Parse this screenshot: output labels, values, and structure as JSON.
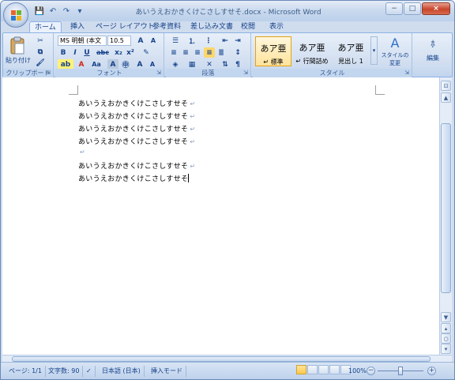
{
  "window": {
    "title": "あいうえおかきくけこさしすせそ.docx - Microsoft Word",
    "minimize": "−",
    "maximize": "□",
    "close": "×"
  },
  "qat": {
    "save": "💾",
    "undo": "↶",
    "redo": "↷",
    "customize": "▾"
  },
  "tabs": [
    "ホーム",
    "挿入",
    "ページ レイアウト",
    "参考資料",
    "差し込み文書",
    "校閲",
    "表示"
  ],
  "ribbon": {
    "clipboard": {
      "label": "クリップボード",
      "paste": "貼り付け"
    },
    "font": {
      "label": "フォント",
      "font_name": "MS 明朝 (本文",
      "font_size": "10.5",
      "bold": "B",
      "italic": "I",
      "underline": "U",
      "strike": "abc",
      "subscript": "x₂",
      "superscript": "x²",
      "grow": "A",
      "shrink": "A",
      "aa": "Aa"
    },
    "paragraph": {
      "label": "段落"
    },
    "styles": {
      "label": "スタイル",
      "items": [
        {
          "preview": "あア亜",
          "name": "↵ 標準"
        },
        {
          "preview": "あア亜",
          "name": "↵ 行間詰め"
        },
        {
          "preview": "あア亜",
          "name": "見出し 1"
        }
      ],
      "change_styles": "スタイルの変更"
    },
    "editing": {
      "label": "編集"
    }
  },
  "document": {
    "lines": [
      "あいうえおかきくけこさしすせそ",
      "あいうえおかきくけこさしすせそ",
      "あいうえおかきくけこさしすせそ",
      "あいうえおかきくけこさしすせそ",
      "",
      "あいうえおかきくけこさしすせそ",
      "あいうえおかきくけこさしすせそ"
    ],
    "para_mark": "↵"
  },
  "status": {
    "page": "ページ: 1/1",
    "word_count": "文字数: 90",
    "language": "日本語 (日本)",
    "insert_mode": "挿入モード",
    "zoom": "100%"
  }
}
